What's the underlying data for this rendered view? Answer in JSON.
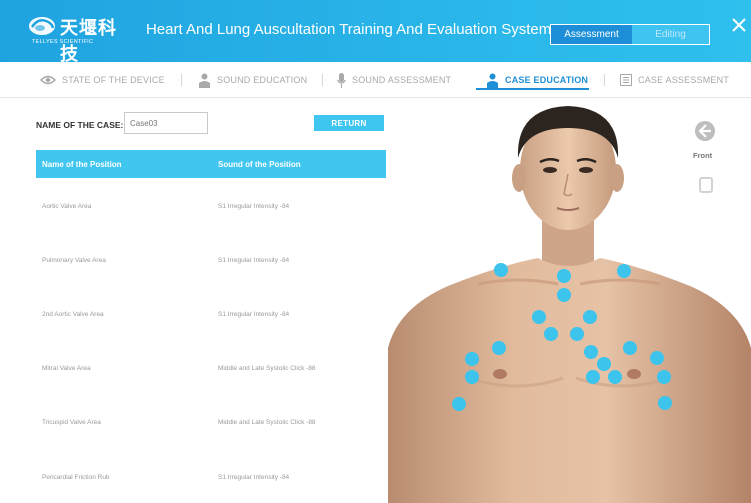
{
  "title_bar": {
    "logo_cn": "天堰科技",
    "logo_en": "TELLYES SCIENTIFIC",
    "app_title": "Heart And Lung Auscultation Training And Evaluation System",
    "mode_assessment": "Assessment",
    "mode_editing": "Editing",
    "colors": {
      "bar": "#29b4e8",
      "active_mode": "#1c8fd8"
    }
  },
  "nav": {
    "tabs": [
      {
        "label": "STATE OF THE DEVICE",
        "icon": "eye-icon"
      },
      {
        "label": "SOUND EDUCATION",
        "icon": "doctor-icon"
      },
      {
        "label": "SOUND ASSESSMENT",
        "icon": "microphone-icon"
      },
      {
        "label": "CASE EDUCATION",
        "icon": "doctor-icon",
        "active": true
      },
      {
        "label": "CASE ASSESSMENT",
        "icon": "list-icon"
      }
    ],
    "active_color": "#1f8fd8"
  },
  "case": {
    "name_label": "NAME OF THE CASE:",
    "name_value": "Case03",
    "return_label": "RETURN"
  },
  "table": {
    "headers": [
      "Name of the Position",
      "Sound of the Position"
    ],
    "rows": [
      [
        "Aortic Valve Area",
        "S1 Irregular Intensity -84"
      ],
      [
        "Pulmonary Valve Area",
        "S1 Irregular Intensity -84"
      ],
      [
        "2nd Aortic Valve Area",
        "S1 Irregular Intensity -84"
      ],
      [
        "Mitral Valve Area",
        "Middle and Late Systolic Click -88"
      ],
      [
        "Tricuspid Valve Area",
        "Middle and Late Systolic Click -88"
      ],
      [
        "Pericardial Friction Rub",
        "S1 Irregular Intensity -84"
      ]
    ],
    "header_color": "#41c6f0"
  },
  "view": {
    "front_label": "Front",
    "marker_color": "#3cc4ec"
  }
}
